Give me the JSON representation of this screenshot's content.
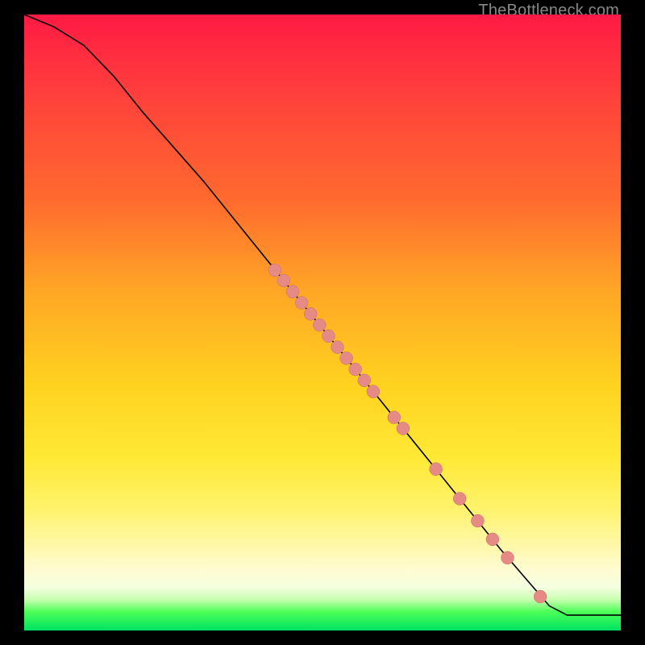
{
  "watermark": "TheBottleneck.com",
  "colors": {
    "dot_fill": "#e58a85",
    "dot_stroke": "#c96f6a",
    "curve": "#000000",
    "frame": "#000000",
    "gradient_stops": [
      "#ff1a44",
      "#ff3d3d",
      "#ff6a2e",
      "#ffa726",
      "#ffd21f",
      "#ffe936",
      "#fff26a",
      "#fffbd0",
      "#f5ffe0",
      "#c7ffb0",
      "#4aff57",
      "#00e262"
    ]
  },
  "chart_data": {
    "type": "line",
    "title": "",
    "xlabel": "",
    "ylabel": "",
    "xlim": [
      0,
      100
    ],
    "ylim": [
      0,
      100
    ],
    "series": [
      {
        "name": "curve",
        "kind": "line",
        "points": [
          {
            "x": 0,
            "y": 100
          },
          {
            "x": 5,
            "y": 98
          },
          {
            "x": 10,
            "y": 95
          },
          {
            "x": 15,
            "y": 90
          },
          {
            "x": 20,
            "y": 84
          },
          {
            "x": 30,
            "y": 73
          },
          {
            "x": 40,
            "y": 61
          },
          {
            "x": 50,
            "y": 49
          },
          {
            "x": 60,
            "y": 37
          },
          {
            "x": 70,
            "y": 25
          },
          {
            "x": 80,
            "y": 13
          },
          {
            "x": 88,
            "y": 4
          },
          {
            "x": 91,
            "y": 2.5
          },
          {
            "x": 100,
            "y": 2.5
          }
        ]
      },
      {
        "name": "dots",
        "kind": "scatter",
        "marker_radius": 8,
        "points": [
          {
            "x": 42,
            "y": 58.5
          },
          {
            "x": 43.5,
            "y": 56.8
          },
          {
            "x": 45,
            "y": 55.0
          },
          {
            "x": 46.5,
            "y": 53.2
          },
          {
            "x": 48,
            "y": 51.4
          },
          {
            "x": 49.5,
            "y": 49.6
          },
          {
            "x": 51,
            "y": 47.8
          },
          {
            "x": 52.5,
            "y": 46.0
          },
          {
            "x": 54,
            "y": 44.2
          },
          {
            "x": 55.5,
            "y": 42.4
          },
          {
            "x": 57,
            "y": 40.6
          },
          {
            "x": 58.5,
            "y": 38.8
          },
          {
            "x": 62,
            "y": 34.6
          },
          {
            "x": 63.5,
            "y": 32.8
          },
          {
            "x": 69,
            "y": 26.2
          },
          {
            "x": 73,
            "y": 21.4
          },
          {
            "x": 76,
            "y": 17.8
          },
          {
            "x": 78.5,
            "y": 14.8
          },
          {
            "x": 81,
            "y": 11.8
          },
          {
            "x": 86.5,
            "y": 5.5
          }
        ]
      }
    ]
  }
}
